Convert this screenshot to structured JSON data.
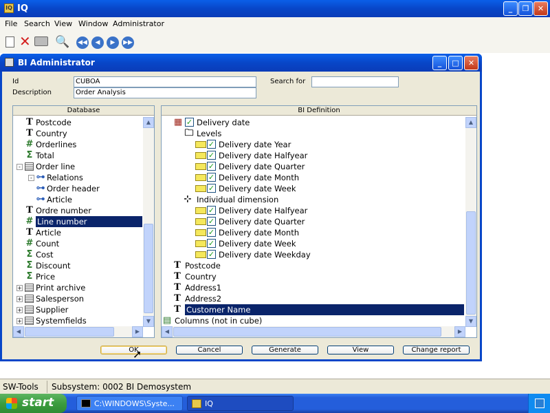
{
  "app": {
    "title": "IQ"
  },
  "menu": [
    "File",
    "Search",
    "View",
    "Window",
    "Administrator"
  ],
  "dialog": {
    "title": "BI Administrator",
    "id_label": "Id",
    "id_value": "CUBOA",
    "desc_label": "Description",
    "desc_value": "Order Analysis",
    "search_label": "Search for",
    "search_value": "",
    "db_header": "Database",
    "bi_header": "BI Definition",
    "db_items": [
      {
        "icon": "T",
        "label": "Postcode"
      },
      {
        "icon": "T",
        "label": "Country"
      },
      {
        "icon": "#",
        "label": "Orderlines"
      },
      {
        "icon": "Σ",
        "label": "Total"
      },
      {
        "icon": "table",
        "label": "Order line"
      },
      {
        "icon": "rel",
        "label": "Relations"
      },
      {
        "icon": "rel",
        "label": "Order header"
      },
      {
        "icon": "rel",
        "label": "Article"
      },
      {
        "icon": "T",
        "label": "Ordre number"
      },
      {
        "icon": "#",
        "label": "Line number"
      },
      {
        "icon": "T",
        "label": "Article"
      },
      {
        "icon": "#",
        "label": "Count"
      },
      {
        "icon": "Σ",
        "label": "Cost"
      },
      {
        "icon": "Σ",
        "label": "Discount"
      },
      {
        "icon": "Σ",
        "label": "Price"
      },
      {
        "icon": "table",
        "label": "Print archive"
      },
      {
        "icon": "table",
        "label": "Salesperson"
      },
      {
        "icon": "table",
        "label": "Supplier"
      },
      {
        "icon": "table",
        "label": "Systemfields"
      }
    ],
    "bi_items": [
      {
        "label": "Delivery date"
      },
      {
        "label": "Levels"
      },
      {
        "label": "Delivery date Year"
      },
      {
        "label": "Delivery date Halfyear"
      },
      {
        "label": "Delivery date Quarter"
      },
      {
        "label": "Delivery date Month"
      },
      {
        "label": "Delivery date Week"
      },
      {
        "label": "Individual dimension"
      },
      {
        "label": "Delivery date Halfyear"
      },
      {
        "label": "Delivery date Quarter"
      },
      {
        "label": "Delivery date Month"
      },
      {
        "label": "Delivery date Week"
      },
      {
        "label": "Delivery date Weekday"
      },
      {
        "label": "Postcode"
      },
      {
        "label": "Country"
      },
      {
        "label": "Address1"
      },
      {
        "label": "Address2"
      },
      {
        "label": "Customer Name"
      },
      {
        "label": "Columns (not in cube)"
      }
    ],
    "buttons": [
      "OK",
      "Cancel",
      "Generate",
      "View",
      "Change report"
    ]
  },
  "status": {
    "left": "SW-Tools",
    "right": "Subsystem: 0002 BI Demosystem"
  },
  "taskbar": {
    "start": "start",
    "task1": "C:\\WINDOWS\\Syste...",
    "task2": "IQ"
  }
}
